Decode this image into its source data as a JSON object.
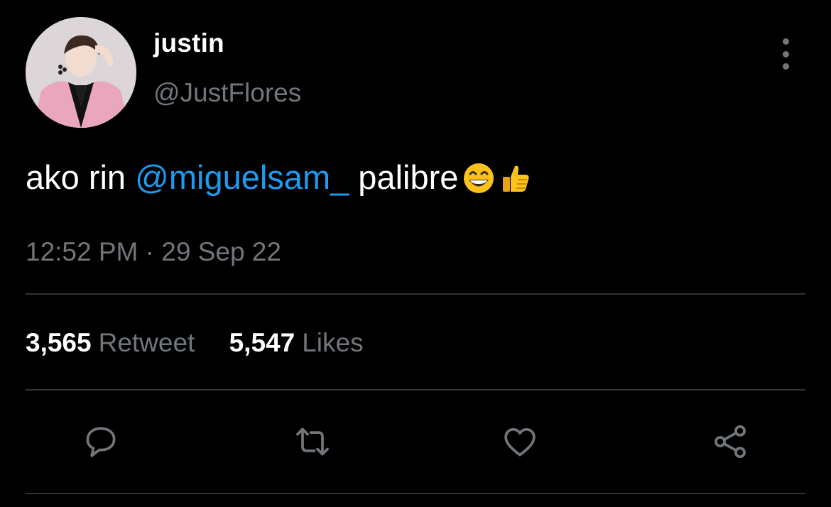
{
  "user": {
    "display_name": "justin",
    "handle": "@JustFlores"
  },
  "tweet": {
    "text_before": "ako rin ",
    "mention": "@miguelsam_",
    "text_after": " palibre",
    "emojis": [
      "grinning-face-smiling-eyes",
      "thumbs-up"
    ],
    "timestamp": "12:52 PM · 29 Sep 22"
  },
  "stats": {
    "retweets_count": "3,565",
    "retweets_label": "Retweet",
    "likes_count": "5,547",
    "likes_label": "Likes"
  },
  "actions": [
    "reply-icon",
    "retweet-icon",
    "like-icon",
    "share-icon"
  ],
  "colors": {
    "background": "#000000",
    "text": "#ffffff",
    "secondary": "#71767b",
    "accent": "#1d9bf0",
    "divider": "#2f3336"
  }
}
